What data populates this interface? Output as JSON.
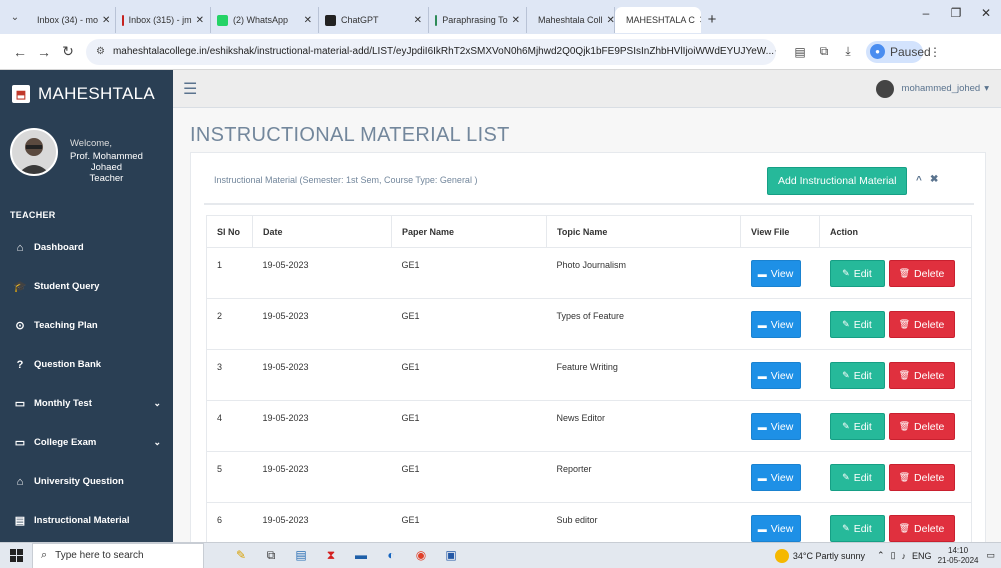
{
  "browser": {
    "tabs": [
      {
        "label": "Inbox (34) - mo",
        "icon": "gmail-icon",
        "color": "#c5221f"
      },
      {
        "label": "Inbox (315) - jm",
        "icon": "gmail-icon",
        "color": "#c5221f"
      },
      {
        "label": "(2) WhatsApp",
        "icon": "whatsapp-icon",
        "color": "#25d366"
      },
      {
        "label": "ChatGPT",
        "icon": "chatgpt-icon",
        "color": "#222222"
      },
      {
        "label": "Paraphrasing To",
        "icon": "quillbot-icon",
        "color": "#2e8b57"
      },
      {
        "label": "Maheshtala Coll",
        "icon": "college-icon",
        "color": "#c0392b"
      },
      {
        "label": "MAHESHTALA C",
        "icon": "college-icon",
        "color": "#c0392b",
        "active": true
      }
    ],
    "new_tab": "+",
    "url": "maheshtalacollege.in/eshikshak/instructional-material-add/LIST/eyJpdiI6IkRhT2xSMXVoN0h6Mjhwd2Q0Qjk1bFE9PSIsInZhbHVlIjoiWWdEYUJYeW...",
    "profile_status": "Paused"
  },
  "app": {
    "brand": "MAHESHTALA",
    "profile": {
      "welcome": "Welcome,",
      "name_line1": "Prof. Mohammed",
      "name_line2": "Johaed",
      "role": "Teacher"
    },
    "section_title": "TEACHER",
    "menu": [
      {
        "label": "Dashboard",
        "icon": "home-icon",
        "glyph": "⌂"
      },
      {
        "label": "Student Query",
        "icon": "graduation-cap-icon",
        "glyph": "🎓"
      },
      {
        "label": "Teaching Plan",
        "icon": "target-icon",
        "glyph": "⊙"
      },
      {
        "label": "Question Bank",
        "icon": "question-circle-icon",
        "glyph": "?"
      },
      {
        "label": "Monthly Test",
        "icon": "monitor-icon",
        "glyph": "▭",
        "has_submenu": true
      },
      {
        "label": "College Exam",
        "icon": "monitor-icon",
        "glyph": "▭",
        "has_submenu": true
      },
      {
        "label": "University Question",
        "icon": "university-icon",
        "glyph": "⌂"
      },
      {
        "label": "Instructional Material",
        "icon": "file-icon",
        "glyph": "▤"
      }
    ],
    "user_name": "mohammed_johed",
    "page_title": "INSTRUCTIONAL MATERIAL LIST",
    "panel": {
      "subtitle": "Instructional Material (Semester: 1st Sem, Course Type: General )",
      "add_button": "Add Instructional Material",
      "collapse": "^",
      "close": "✖"
    },
    "table": {
      "headers": [
        "Sl No",
        "Date",
        "Paper Name",
        "Topic Name",
        "View File",
        "Action"
      ],
      "rows": [
        {
          "sl": "1",
          "date": "19-05-2023",
          "paper": "GE1",
          "topic": "Photo Journalism"
        },
        {
          "sl": "2",
          "date": "19-05-2023",
          "paper": "GE1",
          "topic": "Types of Feature"
        },
        {
          "sl": "3",
          "date": "19-05-2023",
          "paper": "GE1",
          "topic": "Feature Writing"
        },
        {
          "sl": "4",
          "date": "19-05-2023",
          "paper": "GE1",
          "topic": "News Editor"
        },
        {
          "sl": "5",
          "date": "19-05-2023",
          "paper": "GE1",
          "topic": "Reporter"
        },
        {
          "sl": "6",
          "date": "19-05-2023",
          "paper": "GE1",
          "topic": "Sub editor"
        }
      ],
      "view_label": "View",
      "edit_label": "Edit",
      "delete_label": "Delete"
    }
  },
  "taskbar": {
    "search_placeholder": "Type here to search",
    "weather": "34°C  Partly sunny",
    "language": "ENG",
    "time": "14:10",
    "date": "21-05-2024"
  }
}
